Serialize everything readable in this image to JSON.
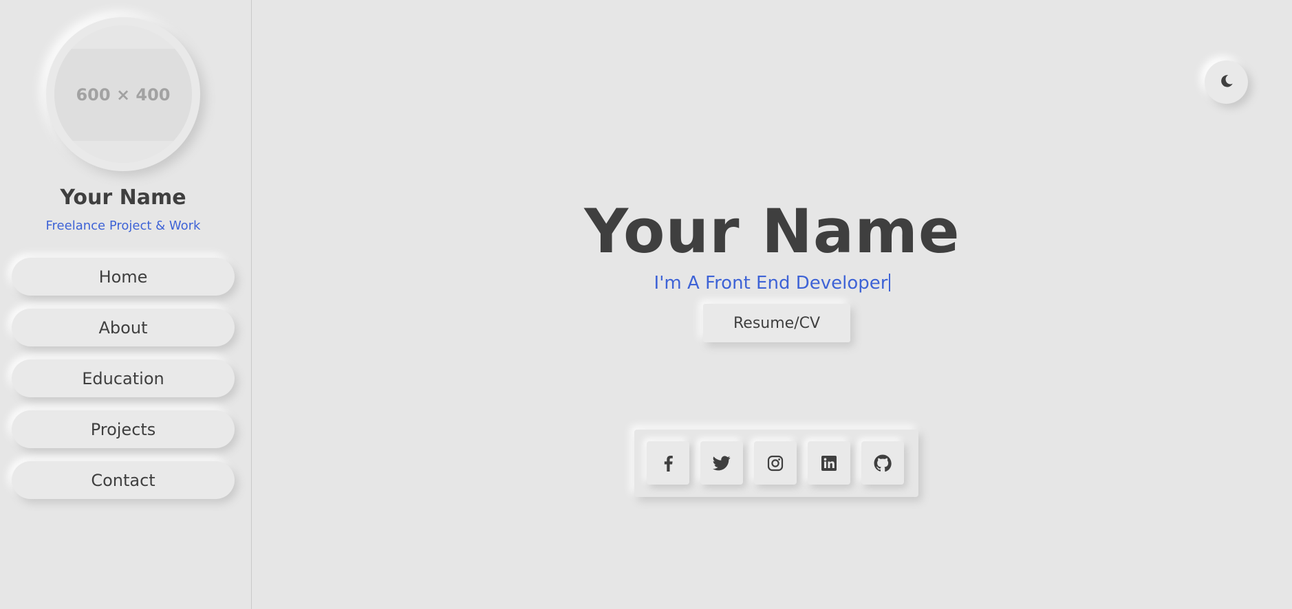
{
  "sidebar": {
    "avatar_placeholder": "600 × 400",
    "name": "Your Name",
    "tagline": "Freelance Project & Work",
    "nav": [
      {
        "label": "Home"
      },
      {
        "label": "About"
      },
      {
        "label": "Education"
      },
      {
        "label": "Projects"
      },
      {
        "label": "Contact"
      }
    ]
  },
  "theme_toggle": {
    "icon": "moon-icon"
  },
  "hero": {
    "name": "Your Name",
    "role": "I'm A Front End Developer",
    "resume_label": "Resume/CV"
  },
  "social": [
    {
      "icon": "facebook-icon"
    },
    {
      "icon": "twitter-icon"
    },
    {
      "icon": "instagram-icon"
    },
    {
      "icon": "linkedin-icon"
    },
    {
      "icon": "github-icon"
    }
  ],
  "colors": {
    "background": "#e6e6e6",
    "text": "#3f3f3f",
    "accent": "#3e63d6"
  }
}
